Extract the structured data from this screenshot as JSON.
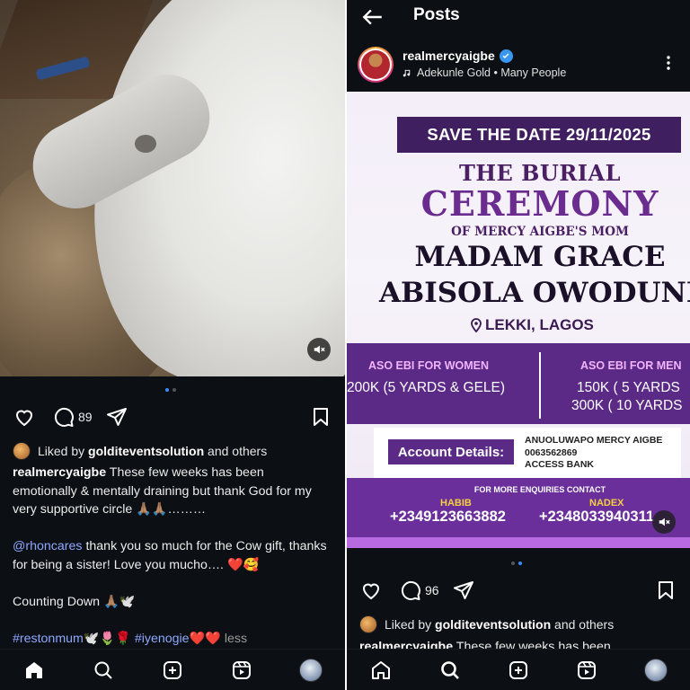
{
  "left_post": {
    "comment_count": "89",
    "liked_by_prefix": "Liked by",
    "liked_by_user": "golditeventsolution",
    "liked_by_suffix": "and others",
    "caption_user": "realmercyaigbe",
    "caption_line1": "These few weeks has been emotionally & mentally draining but thank God for my very supportive circle 🙏🏽🙏🏽………",
    "mention": "@rhoncares",
    "caption_line2": "thank you so much for the Cow gift, thanks for being a sister! Love you mucho…. ❤️🥰",
    "caption_line3": "Counting Down 🙏🏽🕊️",
    "tag1": "#restonmum",
    "tag1_emoji": "🕊️🌷🌹",
    "tag2": "#iyenogie",
    "tag2_emoji": "❤️❤️",
    "less": "less"
  },
  "right_post": {
    "header_title": "Posts",
    "username": "realmercyaigbe",
    "music": "Adekunle Gold • Many People",
    "comment_count": "96",
    "liked_by_prefix": "Liked by",
    "liked_by_user": "golditeventsolution",
    "liked_by_suffix": "and others",
    "caption_peek_user": "realmercyaigbe",
    "caption_peek": "These few weeks has been"
  },
  "flyer": {
    "save_the_date": "SAVE THE DATE  29/11/2025",
    "burial": "THE BURIAL",
    "ceremony": "CEREMONY",
    "of_mom": "OF MERCY AIGBE'S MOM",
    "name1": "MADAM GRACE",
    "name2": "ABISOLA OWODUNNI",
    "location": "LEKKI, LAGOS",
    "aso_women_label": "ASO EBI FOR WOMEN",
    "aso_women_value": "200K (5 YARDS & GELE)",
    "aso_men_label": "ASO EBI FOR MEN",
    "aso_men_value1": "150K ( 5 YARDS",
    "aso_men_value2": "300K ( 10 YARDS",
    "account_label": "Account Details:",
    "account_name": "ANUOLUWAPO MERCY AIGBE",
    "account_number": "0063562869",
    "bank": "ACCESS BANK",
    "contact_head": "FOR MORE ENQUIRIES CONTACT",
    "contact1_name": "HABIB",
    "contact1_number": "+2349123663882",
    "contact2_name": "NADEX",
    "contact2_number": "+2348033940311"
  },
  "colors": {
    "app_bg": "#0c0f14",
    "flyer_purple": "#5b2a86",
    "flyer_dark": "#3f1f5f",
    "link_blue": "#8ea8ff",
    "verified_blue": "#3897f0"
  }
}
